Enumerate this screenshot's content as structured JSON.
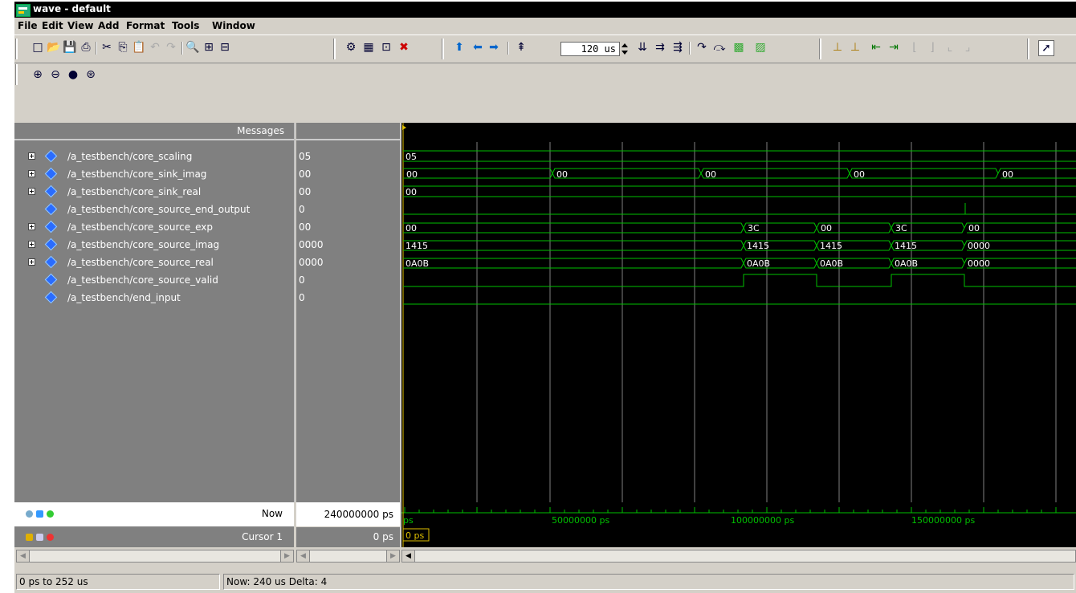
{
  "window": {
    "title": "wave - default"
  },
  "menu": [
    "File",
    "Edit",
    "View",
    "Add",
    "Format",
    "Tools",
    "Window"
  ],
  "toolbar": {
    "time_value": "120 us"
  },
  "panes": {
    "messages_header": "Messages"
  },
  "signals": [
    {
      "name": "/a_testbench/core_scaling",
      "value": "05",
      "expandable": true
    },
    {
      "name": "/a_testbench/core_sink_imag",
      "value": "00",
      "expandable": true
    },
    {
      "name": "/a_testbench/core_sink_real",
      "value": "00",
      "expandable": true
    },
    {
      "name": "/a_testbench/core_source_end_output",
      "value": "0",
      "expandable": false
    },
    {
      "name": "/a_testbench/core_source_exp",
      "value": "00",
      "expandable": true
    },
    {
      "name": "/a_testbench/core_source_imag",
      "value": "0000",
      "expandable": true
    },
    {
      "name": "/a_testbench/core_source_real",
      "value": "0000",
      "expandable": true
    },
    {
      "name": "/a_testbench/core_source_valid",
      "value": "0",
      "expandable": false
    },
    {
      "name": "/a_testbench/end_input",
      "value": "0",
      "expandable": false
    }
  ],
  "wave_labels": {
    "core_scaling": [
      "05"
    ],
    "core_sink_imag": [
      "00",
      "00",
      "00",
      "00",
      "00"
    ],
    "core_sink_real": [
      "00"
    ],
    "core_source_exp": [
      "00",
      "3C",
      "00",
      "3C",
      "00"
    ],
    "core_source_imag": [
      "1415",
      "1415",
      "1415",
      "1415",
      "0000"
    ],
    "core_source_real": [
      "0A0B",
      "0A0B",
      "0A0B",
      "0A0B",
      "0000"
    ]
  },
  "cursors": {
    "now_label": "Now",
    "now_value": "240000000 ps",
    "cursor_label": "Cursor 1",
    "cursor_value": "0 ps",
    "cursor_flag": "0 ps"
  },
  "ruler": {
    "labels": [
      "ps",
      "50000000 ps",
      "100000000 ps",
      "150000000 ps"
    ]
  },
  "status": {
    "range": "0 ps to 252 us",
    "now": "Now: 240 us  Delta: 4"
  },
  "colors": {
    "wave": "#00c000",
    "cursor": "#e0c000",
    "background": "#000000",
    "grid": "#808080"
  }
}
